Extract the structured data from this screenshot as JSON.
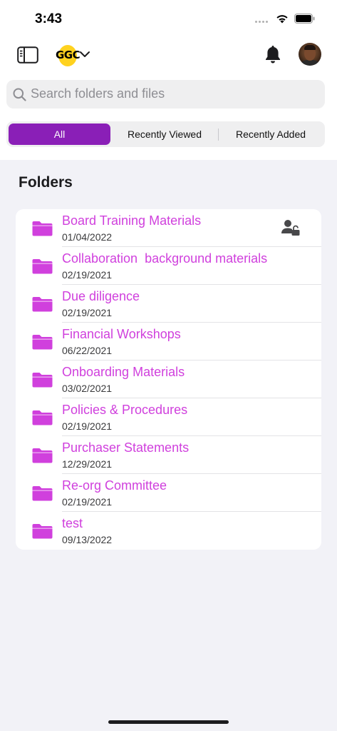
{
  "status_bar": {
    "time": "3:43"
  },
  "header": {
    "logo_text": "GGC",
    "brand_color": "#ffd21f"
  },
  "search": {
    "placeholder": "Search folders and files"
  },
  "tabs": [
    {
      "label": "All",
      "active": true
    },
    {
      "label": "Recently Viewed",
      "active": false
    },
    {
      "label": "Recently Added",
      "active": false
    }
  ],
  "accent_color": "#8a1fb7",
  "folder_color": "#d040dd",
  "folders_section": {
    "title": "Folders",
    "items": [
      {
        "name": "Board Training Materials",
        "date": "01/04/2022",
        "shared_locked": true
      },
      {
        "name": "Collaboration  background materials",
        "date": "02/19/2021"
      },
      {
        "name": "Due diligence",
        "date": "02/19/2021"
      },
      {
        "name": "Financial Workshops",
        "date": "06/22/2021"
      },
      {
        "name": "Onboarding Materials",
        "date": "03/02/2021"
      },
      {
        "name": "Policies & Procedures",
        "date": "02/19/2021"
      },
      {
        "name": "Purchaser Statements",
        "date": "12/29/2021"
      },
      {
        "name": "Re-org Committee",
        "date": "02/19/2021"
      },
      {
        "name": "test",
        "date": "09/13/2022"
      }
    ]
  }
}
